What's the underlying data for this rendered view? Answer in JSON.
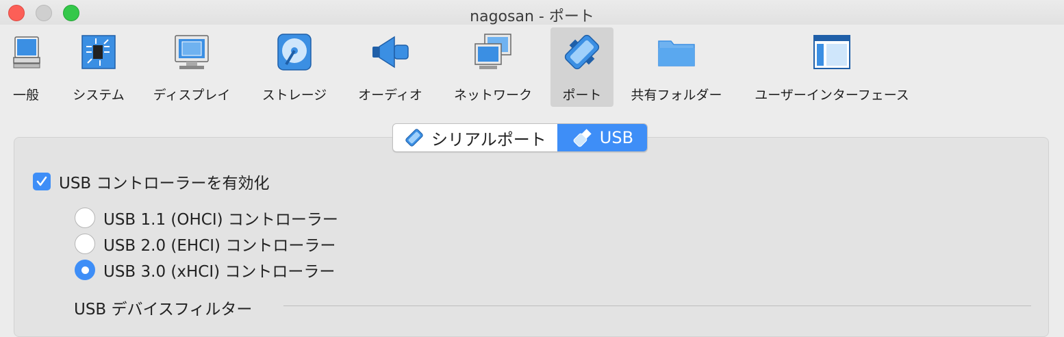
{
  "window": {
    "title": "nagosan - ポート"
  },
  "toolbar": {
    "items": [
      {
        "label": "一般",
        "icon": "general-monitor-icon"
      },
      {
        "label": "システム",
        "icon": "system-chip-icon"
      },
      {
        "label": "ディスプレイ",
        "icon": "display-monitor-icon"
      },
      {
        "label": "ストレージ",
        "icon": "storage-disk-icon"
      },
      {
        "label": "オーディオ",
        "icon": "audio-speaker-icon"
      },
      {
        "label": "ネットワーク",
        "icon": "network-icon"
      },
      {
        "label": "ポート",
        "icon": "port-connector-icon"
      },
      {
        "label": "共有フォルダー",
        "icon": "shared-folder-icon"
      },
      {
        "label": "ユーザーインターフェース",
        "icon": "user-interface-icon"
      }
    ],
    "selected": "ポート"
  },
  "tabs": [
    {
      "label": "シリアルポート",
      "icon": "serial-port-icon",
      "active": false
    },
    {
      "label": "USB",
      "icon": "usb-icon",
      "active": true
    }
  ],
  "usb": {
    "enable_label": "USB コントローラーを有効化",
    "enabled": true,
    "controllers": [
      {
        "label": "USB 1.1 (OHCI) コントローラー",
        "selected": false
      },
      {
        "label": "USB 2.0 (EHCI) コントローラー",
        "selected": false
      },
      {
        "label": "USB 3.0 (xHCI) コントローラー",
        "selected": true
      }
    ],
    "filter_section_label": "USB デバイスフィルター"
  },
  "colors": {
    "accent": "#3e8ef7",
    "close": "#fc5f57",
    "maximize": "#34c84a"
  }
}
